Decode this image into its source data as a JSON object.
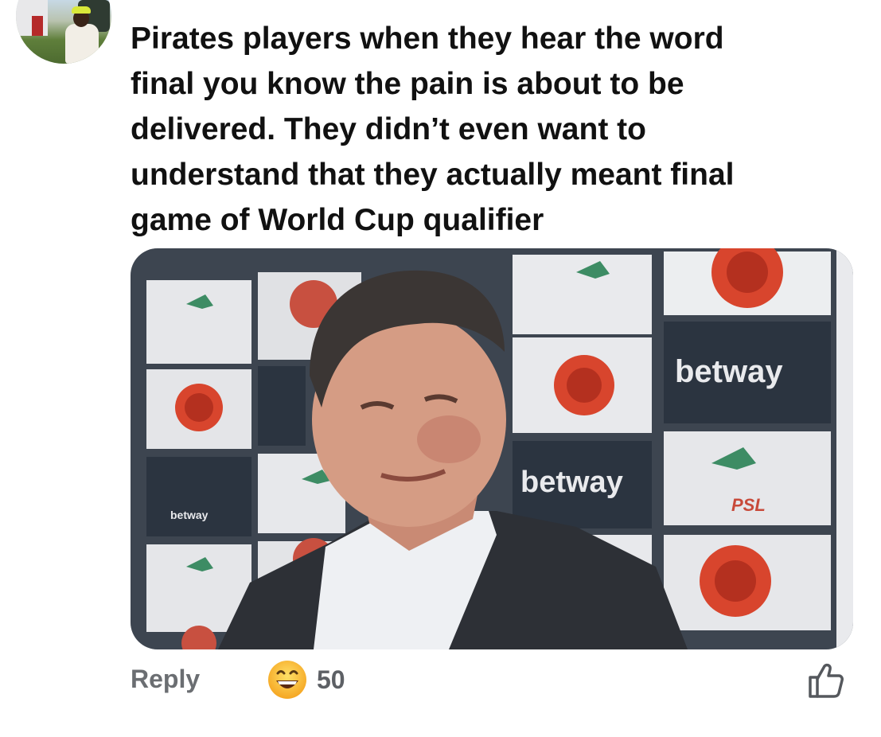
{
  "comment": {
    "lines": [
      "Pirates players when they hear the word",
      "final you know the pain is about to be",
      "delivered. They didn’t even want to",
      "understand that they actually meant final",
      "game of World Cup qualifier"
    ]
  },
  "media": {
    "board_texts": [
      "betway",
      "betway",
      "betway"
    ],
    "board_logo_text": "PSL"
  },
  "actions": {
    "reply_label": "Reply",
    "reaction_count": "50",
    "reaction_icon": "grinning-face-emoji",
    "like_icon": "thumbs-up-icon"
  },
  "colors": {
    "text": "#111111",
    "muted": "#6b6e72",
    "board_dark": "#2b3440",
    "logo_red": "#d8452d"
  }
}
